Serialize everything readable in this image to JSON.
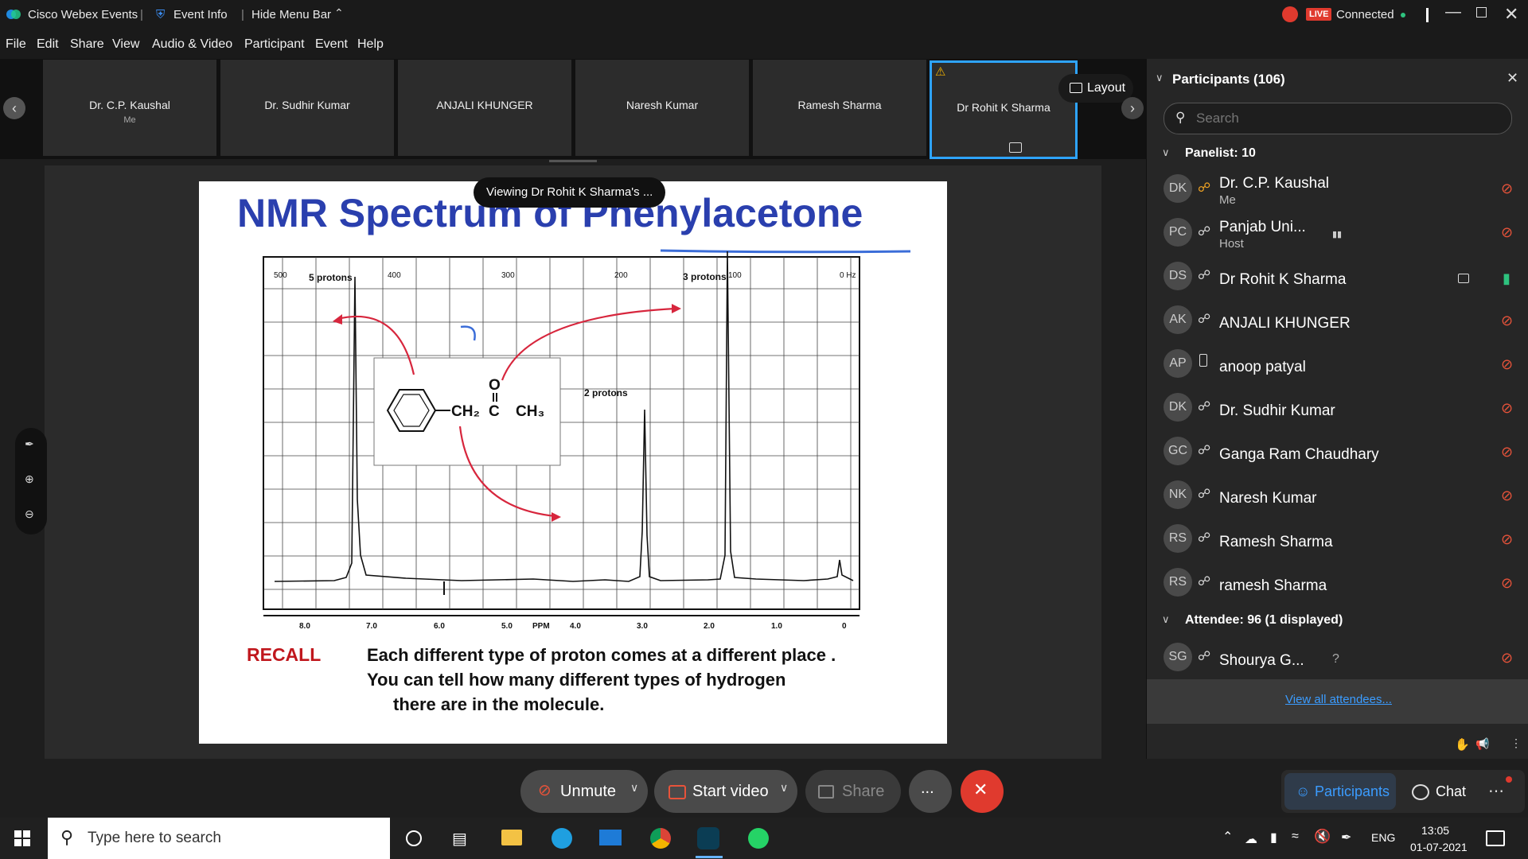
{
  "window": {
    "app_title": "Cisco Webex Events",
    "event_info": "Event Info",
    "hide_menu": "Hide Menu Bar",
    "live_badge": "LIVE",
    "status": "Connected"
  },
  "menu": [
    "File",
    "Edit",
    "Share",
    "View",
    "Audio & Video",
    "Participant",
    "Event",
    "Help"
  ],
  "thumbnails": [
    {
      "name": "Dr. C.P. Kaushal",
      "sub": "Me"
    },
    {
      "name": "Dr. Sudhir Kumar",
      "sub": ""
    },
    {
      "name": "ANJALI KHUNGER",
      "sub": ""
    },
    {
      "name": "Naresh Kumar",
      "sub": ""
    },
    {
      "name": "Ramesh Sharma",
      "sub": ""
    },
    {
      "name": "Dr Rohit K Sharma",
      "sub": ""
    }
  ],
  "layout_button": "Layout",
  "viewing_banner": "Viewing Dr Rohit K Sharma's ...",
  "slide": {
    "title": "NMR Spectrum of Phenylacetone",
    "recall": "RECALL",
    "body_line1": "Each different type of proton comes at a different place .",
    "body_line2": "You can tell how many different types of hydrogen",
    "body_line3": "there are in the molecule.",
    "label_5p": "5 protons",
    "label_3p": "3 protons",
    "label_2p": "2 protons",
    "ppm": "PPM",
    "hz": "0 Hz",
    "ticks_bottom": [
      "8.0",
      "7.0",
      "6.0",
      "5.0",
      "4.0",
      "3.0",
      "2.0",
      "1.0",
      "0"
    ],
    "ticks_top": [
      "500",
      "400",
      "300",
      "200",
      "100"
    ],
    "mol_ch2": "CH₂",
    "mol_c": "C",
    "mol_o": "O",
    "mol_ch3": "CH₃"
  },
  "participants_panel": {
    "title": "Participants (106)",
    "search_placeholder": "Search",
    "panelist_header": "Panelist: 10",
    "panelists": [
      {
        "initials": "DK",
        "name": "Dr. C.P. Kaushal",
        "sub": "Me"
      },
      {
        "initials": "PC",
        "name": "Panjab Uni...",
        "sub": "Host"
      },
      {
        "initials": "DS",
        "name": "Dr Rohit K Sharma",
        "sub": ""
      },
      {
        "initials": "AK",
        "name": "ANJALI KHUNGER",
        "sub": ""
      },
      {
        "initials": "AP",
        "name": "anoop patyal",
        "sub": ""
      },
      {
        "initials": "DK",
        "name": "Dr. Sudhir Kumar",
        "sub": ""
      },
      {
        "initials": "GC",
        "name": "Ganga Ram Chaudhary",
        "sub": ""
      },
      {
        "initials": "NK",
        "name": "Naresh Kumar",
        "sub": ""
      },
      {
        "initials": "RS",
        "name": "Ramesh Sharma",
        "sub": ""
      },
      {
        "initials": "RS",
        "name": "ramesh Sharma",
        "sub": ""
      }
    ],
    "attendee_header": "Attendee: 96 (1 displayed)",
    "attendees": [
      {
        "initials": "SG",
        "name": "Shourya G...",
        "extra": "?"
      }
    ],
    "view_all": "View all attendees..."
  },
  "controls": {
    "unmute": "Unmute",
    "start_video": "Start video",
    "share": "Share",
    "more": "...",
    "participants": "Participants",
    "chat": "Chat"
  },
  "taskbar": {
    "search_placeholder": "Type here to search",
    "lang": "ENG",
    "time": "13:05",
    "date": "01-07-2021"
  },
  "colors": {
    "accent_blue": "#2ea4ff",
    "end_red": "#e03a2e",
    "mute_red": "#e8533a",
    "slide_title_blue": "#2a3fae",
    "recall_red": "#c0171d",
    "arrow_red": "#d7263d"
  }
}
